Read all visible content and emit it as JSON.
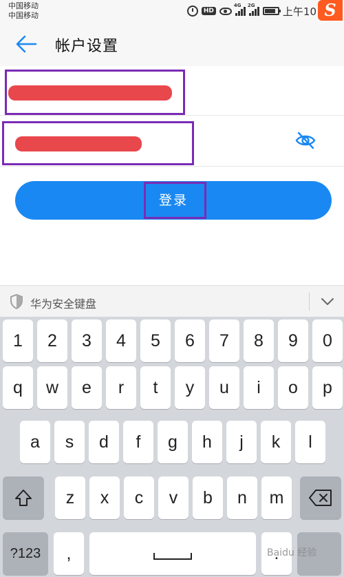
{
  "status_bar": {
    "carrier_1": "中国移动",
    "carrier_2": "中国移动",
    "hd_label": "HD",
    "signal_1_label": "4G",
    "signal_2_label": "2G",
    "time": "上午10",
    "app_icon_glyph": "S"
  },
  "header": {
    "back_icon": "arrow-left-icon",
    "title": "帐户设置"
  },
  "form": {
    "account_field_value": "",
    "password_field_value": "",
    "toggle_visibility_icon": "eye-slash-icon",
    "login_label": "登录",
    "accent_color": "#1a88f2",
    "highlight_color": "#7a2bb5"
  },
  "keyboard": {
    "title": "华为安全键盘",
    "row_numbers": [
      "1",
      "2",
      "3",
      "4",
      "5",
      "6",
      "7",
      "8",
      "9",
      "0"
    ],
    "row_1": [
      "q",
      "w",
      "e",
      "r",
      "t",
      "y",
      "u",
      "i",
      "o",
      "p"
    ],
    "row_2": [
      "a",
      "s",
      "d",
      "f",
      "g",
      "h",
      "j",
      "k",
      "l"
    ],
    "row_3": [
      "z",
      "x",
      "c",
      "v",
      "b",
      "n",
      "m"
    ],
    "mode_key": "?123",
    "comma_key": ",",
    "period_key": "."
  },
  "watermark": "Baidu 经验"
}
